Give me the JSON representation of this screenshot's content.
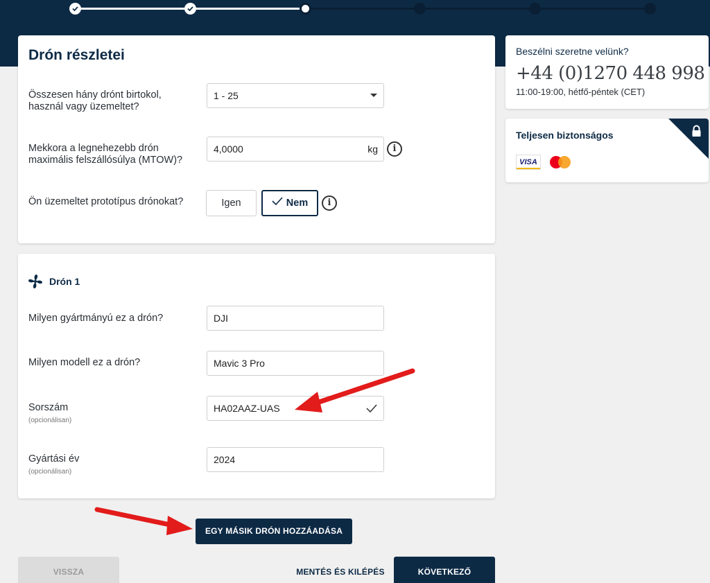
{
  "drone_details": {
    "title": "Drón részletei",
    "count_question": "Összesen hány drónt birtokol, használ vagy üzemeltet?",
    "count_value": "1 - 25",
    "mtow_question": "Mekkora a legnehezebb drón maximális felszállósúlya (MTOW)?",
    "mtow_value": "4,0000",
    "mtow_unit": "kg",
    "prototype_question": "Ön üzemeltet prototípus drónokat?",
    "yes_label": "Igen",
    "no_label": "Nem"
  },
  "drone1": {
    "header": "Drón 1",
    "make_question": "Milyen gyártmányú ez a drón?",
    "make_value": "DJI",
    "model_question": "Milyen modell ez a drón?",
    "model_value": "Mavic 3 Pro",
    "serial_label": "Sorszám",
    "serial_optional": "(opcionálisan)",
    "serial_value": "HA02AAZ-UAS",
    "year_label": "Gyártási év",
    "year_optional": "(opcionálisan)",
    "year_value": "2024"
  },
  "actions": {
    "add_drone": "EGY MÁSIK DRÓN HOZZÁADÁSA",
    "back": "VISSZA",
    "save_exit": "MENTÉS ÉS KILÉPÉS",
    "next": "KÖVETKEZŐ"
  },
  "contact": {
    "title": "Beszélni szeretne velünk?",
    "phone": "+44 (0)1270 448 998",
    "hours": "11:00-19:00, hétfő-péntek (CET)"
  },
  "security": {
    "title": "Teljesen biztonságos",
    "visa": "VISA"
  },
  "progress": {
    "total_steps": 6,
    "current_step": 3
  },
  "colors": {
    "navy": "#0d2a45",
    "annotation_red": "#e21b1b"
  }
}
